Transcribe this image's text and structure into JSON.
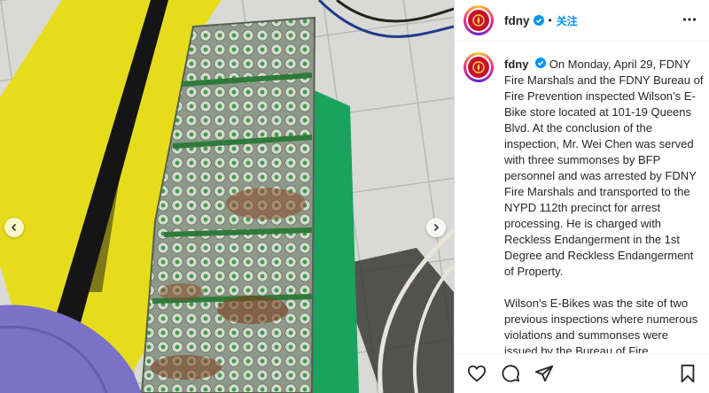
{
  "post": {
    "username": "fdny",
    "follow_label": "关注",
    "separator": "•",
    "caption_paragraph_1": "On Monday, April 29, FDNY Fire Marshals and the FDNY Bureau of Fire Prevention inspected Wilson’s E-Bike store located at 101-19 Queens Blvd. At the conclusion of the inspection, Mr. Wei Chen was served with three summonses by BFP personnel and was arrested by FDNY Fire Marshals and transported to the NYPD 112th precinct for arrest processing. He is charged with Reckless Endangerment in the 1st Degree and Reckless Endangerment of Property.",
    "caption_paragraph_2": "Wilson’s E-Bikes was the site of two previous inspections where numerous violations and summonses were issued by the Bureau of Fire Prevention"
  },
  "icons": {
    "verified": "verified-badge-icon",
    "more": "more-options-icon",
    "like": "heart-icon",
    "comment": "comment-icon",
    "share": "send-icon",
    "save": "bookmark-icon",
    "prev": "chevron-left-icon",
    "next": "chevron-right-icon"
  },
  "colors": {
    "accent": "#0095f6",
    "text": "#262626",
    "fdny_red": "#c8102e"
  }
}
